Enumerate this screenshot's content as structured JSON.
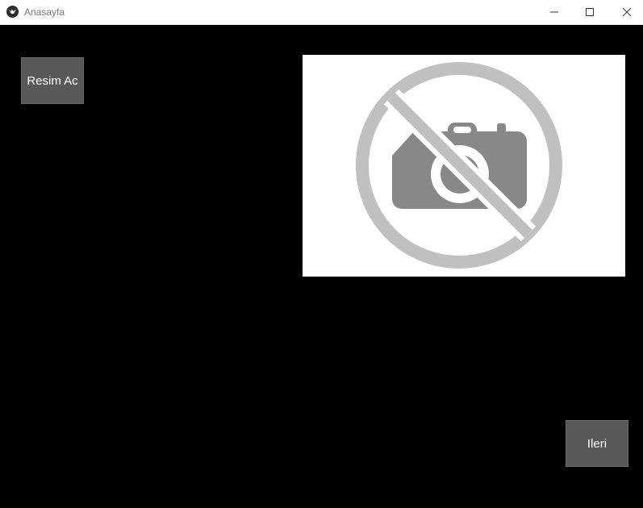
{
  "window": {
    "title": "Anasayfa",
    "icon": "kivy-app-icon",
    "controls": {
      "minimize_icon": "minimize-icon",
      "maximize_icon": "maximize-icon",
      "close_icon": "close-icon"
    }
  },
  "main": {
    "open_image_button": "Resim Ac",
    "next_button": "Ileri",
    "image_placeholder_icon": "no-camera-icon"
  },
  "colors": {
    "background": "#000000",
    "button": "#585858",
    "button_text": "#ffffff",
    "image_background": "#ffffff",
    "placeholder_ring": "#c0c0c0",
    "placeholder_camera": "#888888"
  }
}
